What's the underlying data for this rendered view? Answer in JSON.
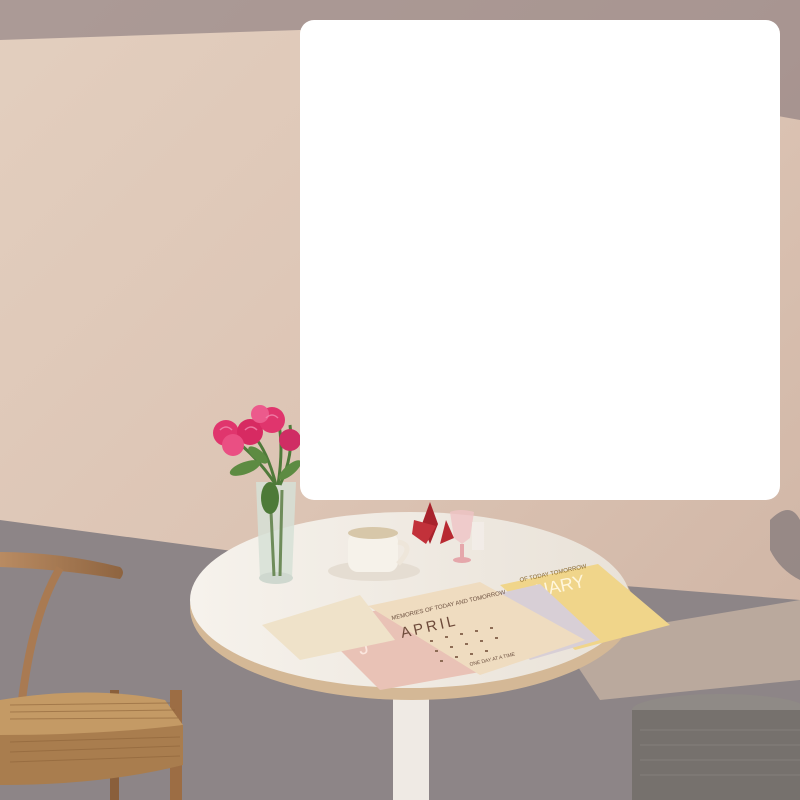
{
  "scene": {
    "wall_color": "#dcc6b6",
    "shadow_color": "#8f8789",
    "table_color": "#f3eee6",
    "rose_color": "#e0356d"
  },
  "calendars": [
    {
      "caption": "MEMORIES OF TODAY AND TOMORROW",
      "month": "APRIL",
      "footer": "ONE DAY AT A TIME"
    },
    {
      "caption": "OF TODAY TOMORROW",
      "month": "UARY"
    },
    {
      "caption": "MEMORIES OF TODAY AND TOMORROW",
      "month": "J"
    }
  ]
}
